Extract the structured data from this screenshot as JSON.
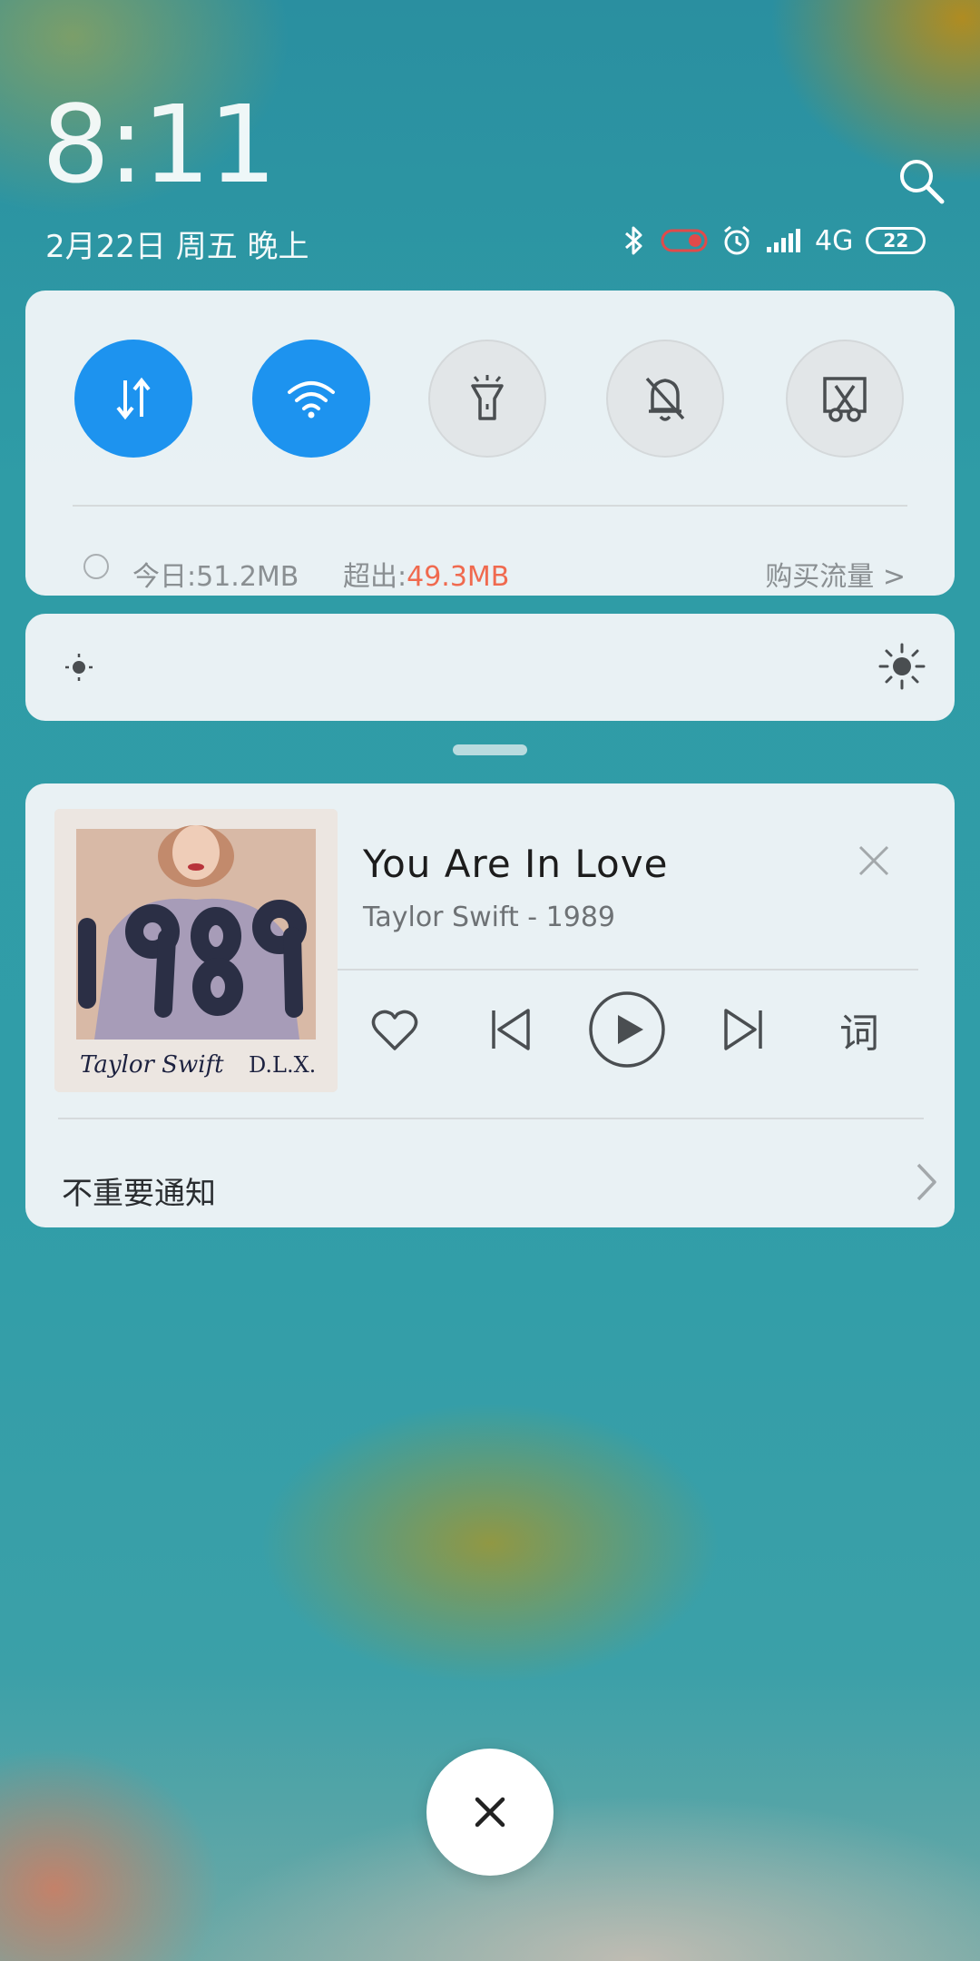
{
  "status": {
    "time": "8:11",
    "date": "2月22日 周五 晚上",
    "network_type": "4G",
    "battery_level": "22",
    "icons": [
      "bluetooth-icon",
      "toggle-icon",
      "alarm-icon",
      "signal-icon"
    ]
  },
  "quick_toggles": [
    {
      "name": "mobile-data",
      "icon": "arrows-updown-icon",
      "active": true
    },
    {
      "name": "wifi",
      "icon": "wifi-icon",
      "active": true
    },
    {
      "name": "flashlight",
      "icon": "flashlight-icon",
      "active": false
    },
    {
      "name": "mute",
      "icon": "bell-off-icon",
      "active": false
    },
    {
      "name": "screenshot",
      "icon": "scissors-icon",
      "active": false
    }
  ],
  "data_usage": {
    "today_label": "今日:",
    "today_value": "51.2MB",
    "over_label": "超出:",
    "over_value": "49.3MB",
    "buy_link": "购买流量 >"
  },
  "media": {
    "title": "You Are In Love",
    "artist_album": "Taylor Swift - 1989",
    "album_art": {
      "big_text": "1989",
      "caption_left": "Taylor Swift",
      "caption_right": "D.L.X."
    },
    "lyrics_button": "词"
  },
  "notifications": {
    "unimportant_label": "不重要通知"
  },
  "colors": {
    "accent": "#1d93ef",
    "over_usage": "#f06a4f"
  }
}
